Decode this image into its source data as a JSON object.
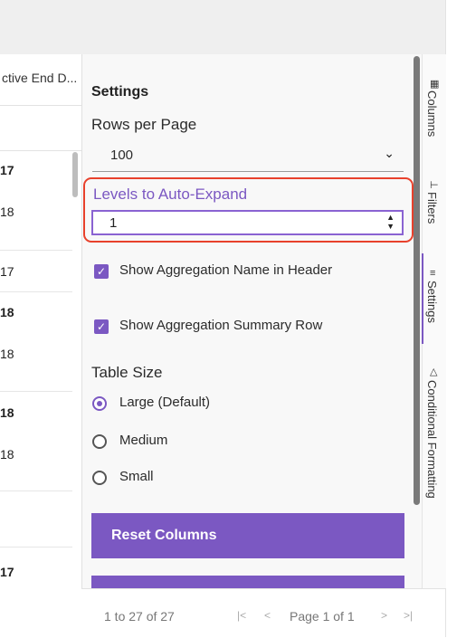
{
  "grid": {
    "header_label": "ctive End D...",
    "cells": [
      {
        "text": "17",
        "bold": true
      },
      {
        "text": "18",
        "bold": false
      },
      {
        "text": "17",
        "bold": false
      },
      {
        "text": "18",
        "bold": true
      },
      {
        "text": "18",
        "bold": false
      },
      {
        "text": "18",
        "bold": true
      },
      {
        "text": "18",
        "bold": false
      },
      {
        "text": "17",
        "bold": true
      }
    ]
  },
  "settings": {
    "title": "Settings",
    "rows_per_page_label": "Rows per Page",
    "rows_per_page_value": "100",
    "levels_label": "Levels to Auto-Expand",
    "levels_value": "1",
    "show_agg_name": "Show Aggregation Name in Header",
    "show_agg_summary": "Show Aggregation Summary Row",
    "table_size_label": "Table Size",
    "sizes": [
      "Large (Default)",
      "Medium",
      "Small"
    ],
    "selected_size": "Large (Default)",
    "reset_columns": "Reset Columns"
  },
  "footer": {
    "count": "1 to 27 of 27",
    "page": "Page 1 of 1"
  },
  "sidebar_tabs": {
    "columns": "Columns",
    "filters": "Filters",
    "settings": "Settings",
    "conditional_formatting": "Conditional Formatting"
  },
  "colors": {
    "accent": "#7b58c2",
    "highlight": "#e8412c"
  }
}
